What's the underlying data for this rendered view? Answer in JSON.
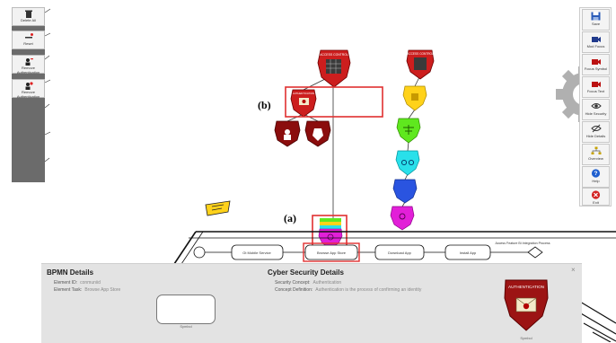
{
  "left_toolbar": {
    "items": [
      {
        "label": "Delete All",
        "icon": "trash-icon"
      },
      {
        "label": "Reset",
        "icon": "minus-icon"
      },
      {
        "label": "Remove Authentication",
        "icon": "user-remove-icon"
      },
      {
        "label": "Remove Authentication",
        "icon": "gear-user-icon"
      }
    ]
  },
  "right_toolbar": {
    "items": [
      {
        "label": "Save",
        "icon": "save-icon"
      },
      {
        "label": "Mod Focus",
        "icon": "camera-icon"
      },
      {
        "label": "Focus Symbol",
        "icon": "camera-red-icon"
      },
      {
        "label": "Focus Text",
        "icon": "camera-red-icon"
      },
      {
        "label": "Hide Security",
        "icon": "eye-icon"
      },
      {
        "label": "Hide Details",
        "icon": "eye-slash-icon"
      },
      {
        "label": "Overview",
        "icon": "tree-icon"
      },
      {
        "label": "Help",
        "icon": "help-icon"
      },
      {
        "label": "Exit",
        "icon": "close-icon"
      }
    ]
  },
  "callouts": {
    "a": "(a)",
    "b": "(b)"
  },
  "diagram": {
    "top_shield_label": "ACCESS CONTROL",
    "right_chain_top_label": "ACCESS CONTROL",
    "child_shield_label": "AUTHENTICATION",
    "tasks": [
      "Gt Mobile Service",
      "Browse App Store",
      "Download App",
      "Install App"
    ],
    "end_note": "Access Feature Bi Integration Process"
  },
  "bpmn": {
    "title": "BPMN Details",
    "element_id_label": "Element ID:",
    "element_id_value": "conmuniid",
    "element_task_label": "Element Task:",
    "element_task_value": "Browse App Store",
    "symbol_caption": "Symbol"
  },
  "cyber": {
    "title": "Cyber Security Details",
    "concept_label": "Security Concept:",
    "concept_value": "Authentication",
    "definition_label": "Concept Definition:",
    "definition_value": "Authentication is the process of confirming an identity",
    "badge_text": "AUTHENTICATION",
    "symbol_caption": "Symbol"
  },
  "colors": {
    "dark_red": "#8b0d0d",
    "red": "#cc1e1e",
    "yellow": "#ffd21a",
    "green": "#5fe81e",
    "cyan": "#29e0ea",
    "blue": "#2a54e0",
    "magenta": "#e21fd8",
    "highlight": "#e03030"
  }
}
